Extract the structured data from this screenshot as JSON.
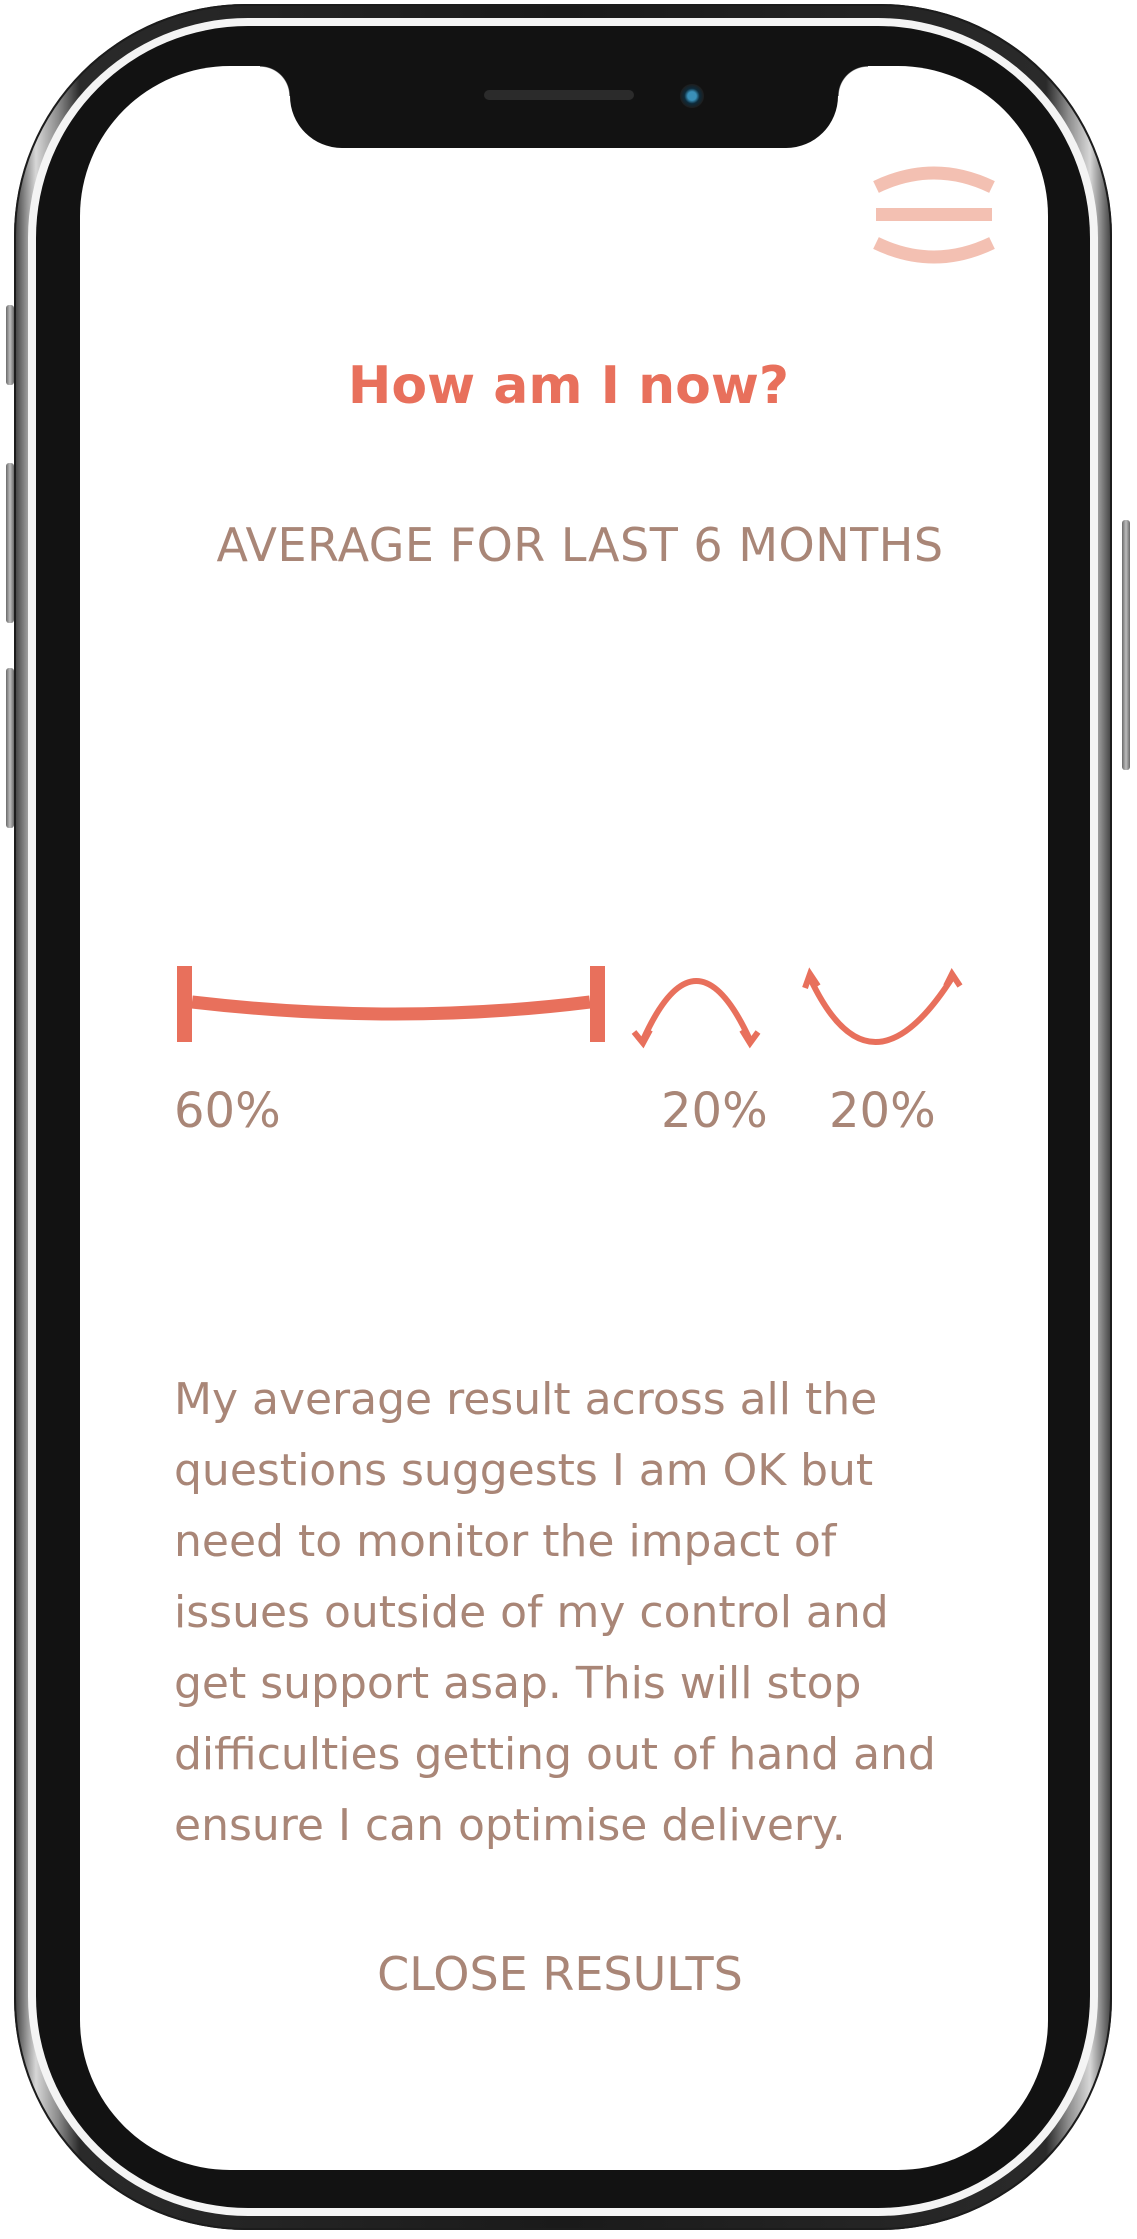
{
  "header": {
    "menu_icon": "hamburger-menu-icon"
  },
  "main": {
    "title": "How am I now?",
    "subtitle": "AVERAGE FOR LAST 6 MONTHS",
    "breakdown": [
      {
        "icon": "flat-line-icon",
        "percent": "60%",
        "value": 60
      },
      {
        "icon": "frown-arc-icon",
        "percent": "20%",
        "value": 20
      },
      {
        "icon": "smile-arc-icon",
        "percent": "20%",
        "value": 20
      }
    ],
    "description": "My average result across all the questions suggests I am OK but need to monitor the impact of issues outside of my control and get support asap. This will stop difficulties getting out of hand and ensure I can optimise delivery.",
    "close_label": "CLOSE RESULTS"
  },
  "colors": {
    "accent": "#e8705c",
    "accent_light": "#f3c0b2",
    "text": "#a98677",
    "background": "#ffffff"
  }
}
